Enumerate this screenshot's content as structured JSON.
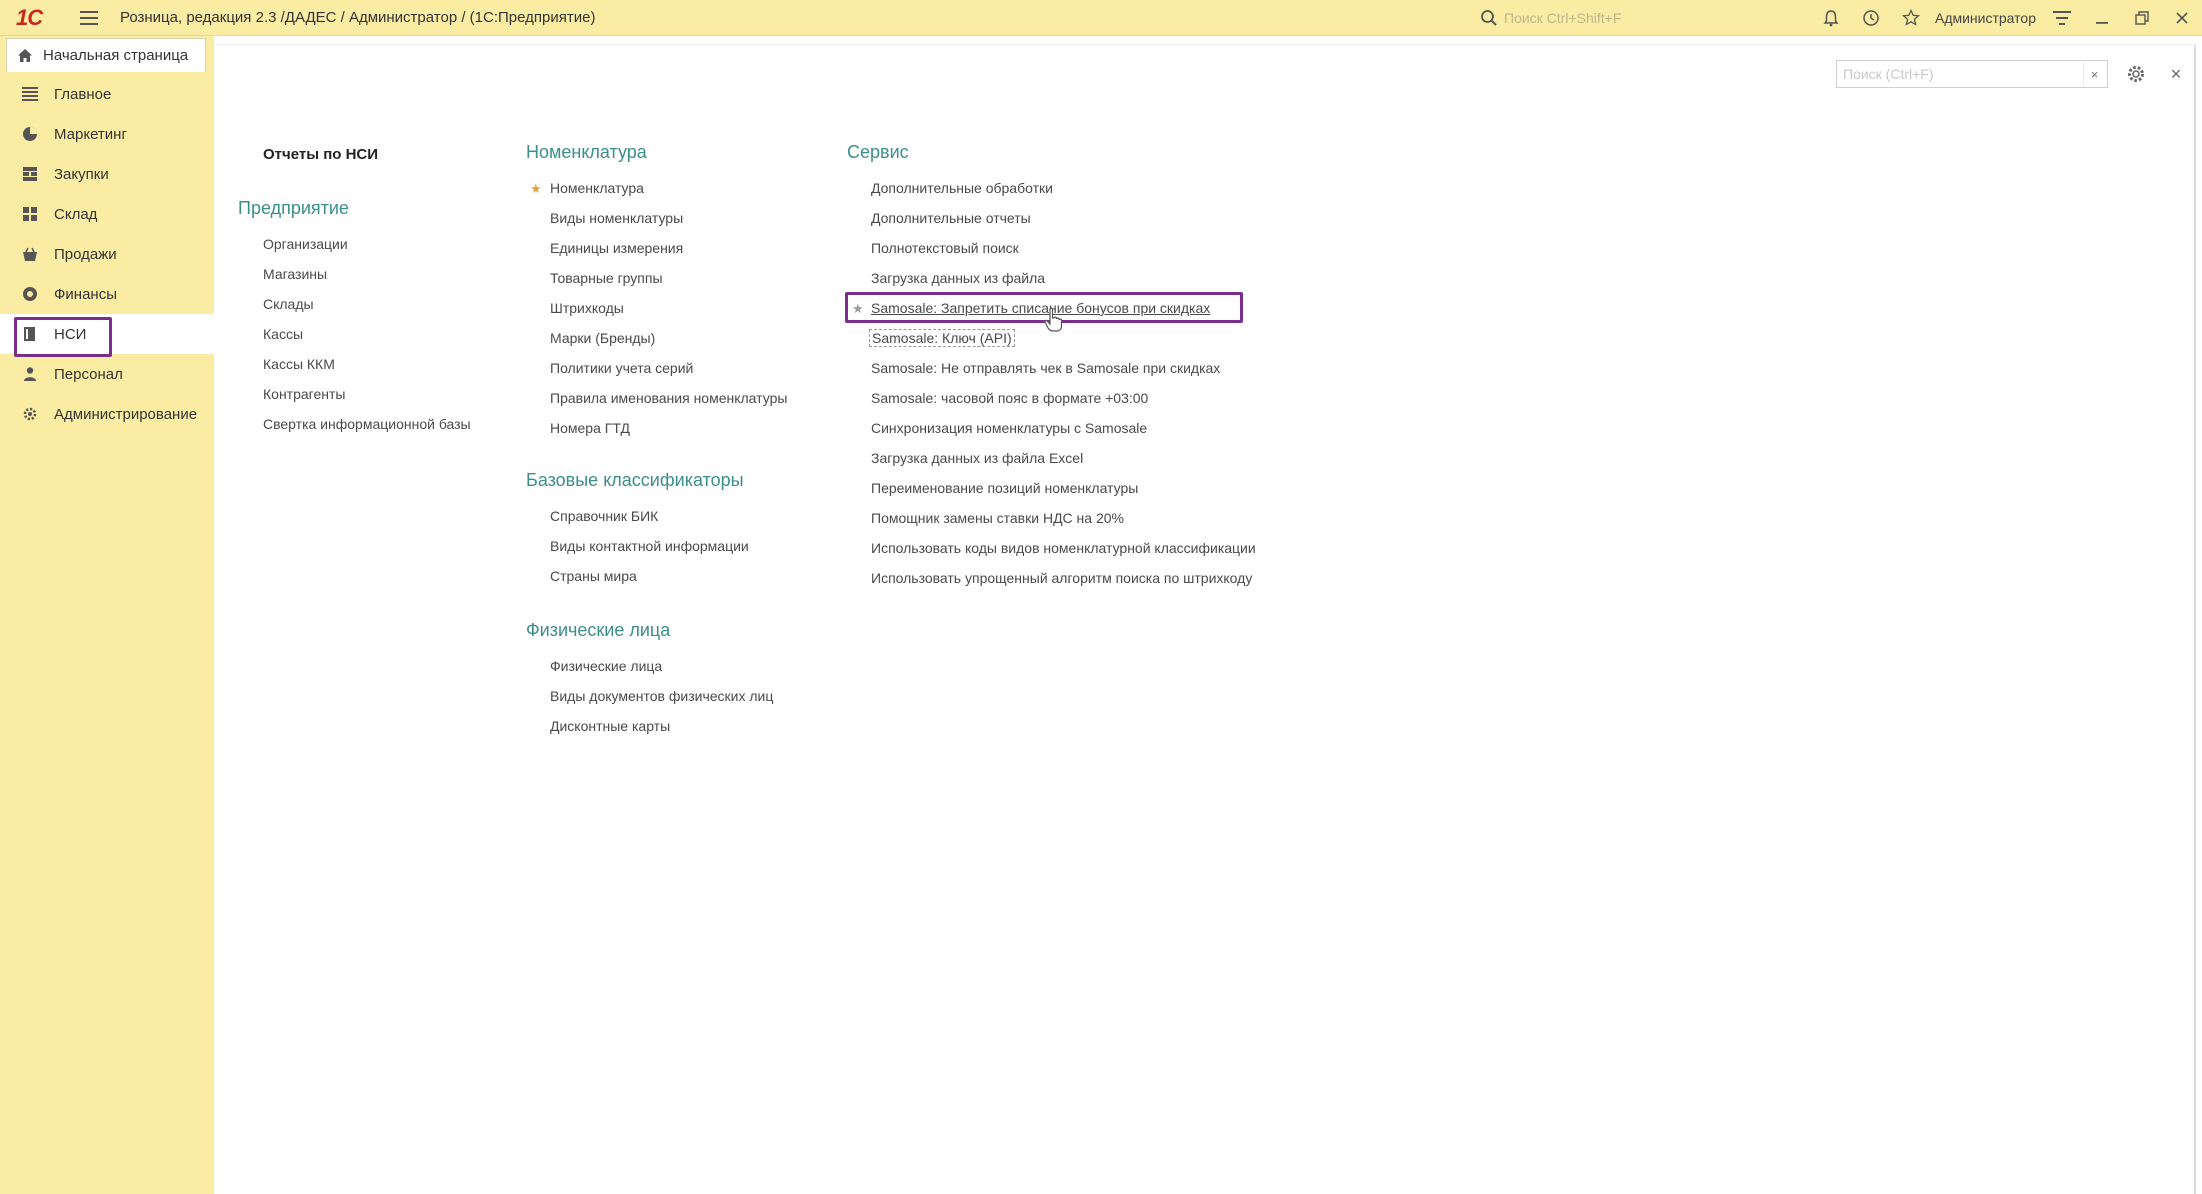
{
  "titlebar": {
    "logo": "1С",
    "title": "Розница, редакция 2.3 /ДАДЕС / Администратор /  (1С:Предприятие)",
    "search_placeholder": "Поиск Ctrl+Shift+F",
    "user": "Администратор"
  },
  "sidebar": {
    "home_tab": "Начальная страница",
    "items": [
      {
        "label": "Главное",
        "icon": "list-icon"
      },
      {
        "label": "Маркетинг",
        "icon": "pie-chart-icon"
      },
      {
        "label": "Закупки",
        "icon": "purchases-icon"
      },
      {
        "label": "Склад",
        "icon": "grid-icon"
      },
      {
        "label": "Продажи",
        "icon": "basket-icon"
      },
      {
        "label": "Финансы",
        "icon": "coins-icon"
      },
      {
        "label": "НСИ",
        "icon": "book-icon",
        "active": true
      },
      {
        "label": "Персонал",
        "icon": "person-icon"
      },
      {
        "label": "Администрирование",
        "icon": "gear-icon"
      }
    ]
  },
  "form": {
    "search_placeholder": "Поиск (Ctrl+F)",
    "clear": "×",
    "close": "×"
  },
  "col1": {
    "reports_title": "Отчеты по НСИ",
    "enterprise_title": "Предприятие",
    "enterprise_items": [
      "Организации",
      "Магазины",
      "Склады",
      "Кассы",
      "Кассы ККМ",
      "Контрагенты",
      "Свертка информационной базы"
    ]
  },
  "col2": {
    "nomenclature_title": "Номенклатура",
    "nomenclature_items": [
      "Номенклатура",
      "Виды номенклатуры",
      "Единицы измерения",
      "Товарные группы",
      "Штрихкоды",
      "Марки (Бренды)",
      "Политики учета серий",
      "Правила именования номенклатуры",
      "Номера ГТД"
    ],
    "classifiers_title": "Базовые классификаторы",
    "classifiers_items": [
      "Справочник БИК",
      "Виды контактной информации",
      "Страны мира"
    ],
    "persons_title": "Физические лица",
    "persons_items": [
      "Физические лица",
      "Виды документов физических лиц",
      "Дисконтные карты"
    ]
  },
  "col3": {
    "service_title": "Сервис",
    "service_items": [
      "Дополнительные обработки",
      "Дополнительные отчеты",
      "Полнотекстовый поиск",
      "Загрузка данных из файла",
      "Samosale: Запретить списание бонусов при скидках",
      "Samosale: Ключ (API)",
      "Samosale: Не отправлять чек в Samosale при скидках",
      "Samosale: часовой пояс в формате +03:00",
      "Синхронизация номенклатуры с Samosale",
      "Загрузка данных из файла Excel",
      "Переименование позиций номенклатуры",
      "Помощник замены ставки НДС на 20%",
      "Использовать коды видов номенклатурной классификации",
      "Использовать упрощенный алгоритм поиска по штрихкоду"
    ]
  },
  "colors": {
    "accent": "#3a8f8a",
    "titlebar_bg": "#fbeca4",
    "highlight": "#7a2e8c",
    "star": "#e8a23a"
  }
}
